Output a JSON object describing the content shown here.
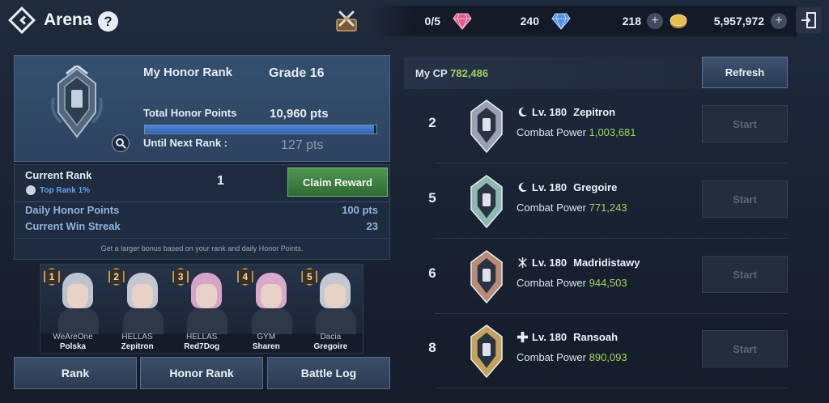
{
  "header": {
    "title": "Arena",
    "help": "?",
    "resources": {
      "tickets": "0/5",
      "red_gems": "240",
      "blue_gems": "218",
      "adena": "5,957,972"
    }
  },
  "honor": {
    "my_rank_label": "My Honor Rank",
    "grade": "Grade 16",
    "total_label": "Total Honor Points",
    "total_value": "10,960 pts",
    "next_label": "Until Next Rank :",
    "next_value": "127 pts",
    "progress_fraction": 0.99
  },
  "rank_info": {
    "current_rank_label": "Current Rank",
    "current_rank_value": "1",
    "top_rank": "Top Rank 1%",
    "claim_label": "Claim Reward",
    "daily_label": "Daily Honor Points",
    "daily_value": "100 pts",
    "streak_label": "Current Win Streak",
    "streak_value": "23",
    "note": "Get a larger bonus based on your rank and daily Honor Points."
  },
  "top5": [
    {
      "rank": "1",
      "guild": "WeAreOne",
      "name": "Polska",
      "hair": "#bfc3cf"
    },
    {
      "rank": "2",
      "guild": "HELLAS",
      "name": "Zepitron",
      "hair": "#c4c7d1"
    },
    {
      "rank": "3",
      "guild": "HELLAS",
      "name": "Red7Dog",
      "hair": "#d7a3c8"
    },
    {
      "rank": "4",
      "guild": "GYM",
      "name": "Sharen",
      "hair": "#d9a8cc"
    },
    {
      "rank": "5",
      "guild": "Dacia",
      "name": "Gregoire",
      "hair": "#c4c7d1"
    }
  ],
  "tabs": [
    "Rank",
    "Honor Rank",
    "Battle Log"
  ],
  "right": {
    "my_cp_label": "My CP",
    "my_cp_value": "782,486",
    "refresh_label": "Refresh",
    "opponents": [
      {
        "rank": "2",
        "level": "Lv. 180",
        "name": "Zepitron",
        "cp_label": "Combat Power",
        "cp": "1,003,681",
        "start": "Start",
        "emblem_color": "#9aa2b1",
        "class_icon": "moon-icon"
      },
      {
        "rank": "5",
        "level": "Lv. 180",
        "name": "Gregoire",
        "cp_label": "Combat Power",
        "cp": "771,243",
        "start": "Start",
        "emblem_color": "#8fb8b1",
        "class_icon": "moon-icon"
      },
      {
        "rank": "6",
        "level": "Lv. 180",
        "name": "Madridistawy",
        "cp_label": "Combat Power",
        "cp": "944,503",
        "start": "Start",
        "emblem_color": "#b98a78",
        "class_icon": "staff-icon"
      },
      {
        "rank": "8",
        "level": "Lv. 180",
        "name": "Ransoah",
        "cp_label": "Combat Power",
        "cp": "890,093",
        "start": "Start",
        "emblem_color": "#c4a25a",
        "class_icon": "cross-icon"
      }
    ]
  },
  "colors": {
    "accent_green": "#9fd35a",
    "claim_green": "#3f8a42",
    "progress_blue": "#3f74c4"
  }
}
